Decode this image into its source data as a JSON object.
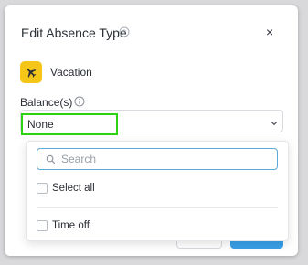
{
  "dialog": {
    "title": "Edit Absence Type",
    "close_symbol": "×"
  },
  "absence_type": {
    "name": "Vacation",
    "icon": "airplane-icon",
    "icon_color": "#f5c518"
  },
  "balances": {
    "label": "Balance(s)",
    "selected_value": "None",
    "highlight_color": "#2bd20e"
  },
  "dropdown": {
    "search_placeholder": "Search",
    "select_all_label": "Select all",
    "options": [
      {
        "label": "Time off",
        "checked": false
      }
    ]
  },
  "colors": {
    "primary": "#3aa0e8",
    "search_border": "#5aa9d6"
  }
}
